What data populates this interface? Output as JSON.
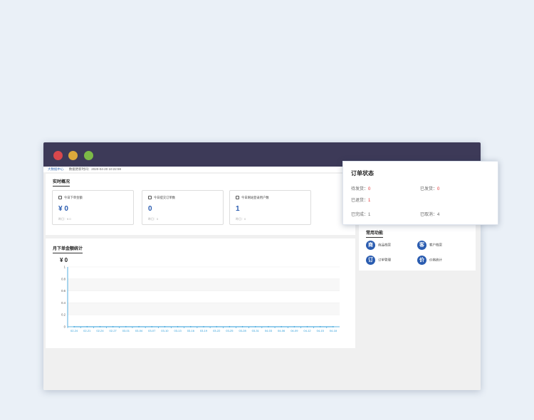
{
  "breadcrumb": {
    "home": "大数据中心",
    "updated": "数据更新时间：2020-04-20 10:22:59"
  },
  "realtime": {
    "title": "实时概况",
    "cards": [
      {
        "label": "今日下单金额",
        "value": "¥ 0",
        "compare": "昨日：¥ 0"
      },
      {
        "label": "今日提交订单数",
        "value": "0",
        "compare": "昨日：0"
      },
      {
        "label": "今日网站登录用户数",
        "value": "1",
        "compare": "昨日：0"
      }
    ]
  },
  "monthly": {
    "title": "月下单金额统计",
    "total": "¥ 0"
  },
  "shortcuts": {
    "title": "常用功能",
    "items": [
      {
        "icon": "商",
        "label": "商品档案"
      },
      {
        "icon": "客",
        "label": "客户档案"
      },
      {
        "icon": "订",
        "label": "订单管理"
      },
      {
        "icon": "价",
        "label": "价格统计"
      }
    ]
  },
  "order_status": {
    "title": "订单状态",
    "items": [
      {
        "label": "待发货：",
        "value": "0"
      },
      {
        "label": "已发货：",
        "value": "0"
      },
      {
        "label": "已退货：",
        "value": "1"
      },
      {
        "label": "已完成：",
        "value": "1"
      },
      {
        "label": "已取消：",
        "value": "4"
      }
    ]
  },
  "colors": {
    "accent": "#2a5cb0",
    "titlebar": "#3d3a58",
    "axis": "#2a9bd8",
    "alert": "#e03030"
  },
  "chart_data": {
    "type": "line",
    "categories": [
      "02-24",
      "02-21",
      "02-24",
      "02-27",
      "03-01",
      "03-04",
      "03-07",
      "03-10",
      "03-13",
      "03-16",
      "03-19",
      "03-22",
      "03-25",
      "03-28",
      "03-31",
      "04-03",
      "04-06",
      "04-09",
      "04-12",
      "04-15",
      "04-18"
    ],
    "series": [
      {
        "values": [
          0,
          0,
          0,
          0,
          0,
          0,
          0,
          0,
          0,
          0,
          0,
          0,
          0,
          0,
          0,
          0,
          0,
          0,
          0,
          0,
          0
        ]
      }
    ],
    "yticks": [
      "1",
      "0.8",
      "0.6",
      "0.4",
      "0.2",
      "0"
    ],
    "ylim": [
      0,
      1
    ],
    "grid": true
  }
}
